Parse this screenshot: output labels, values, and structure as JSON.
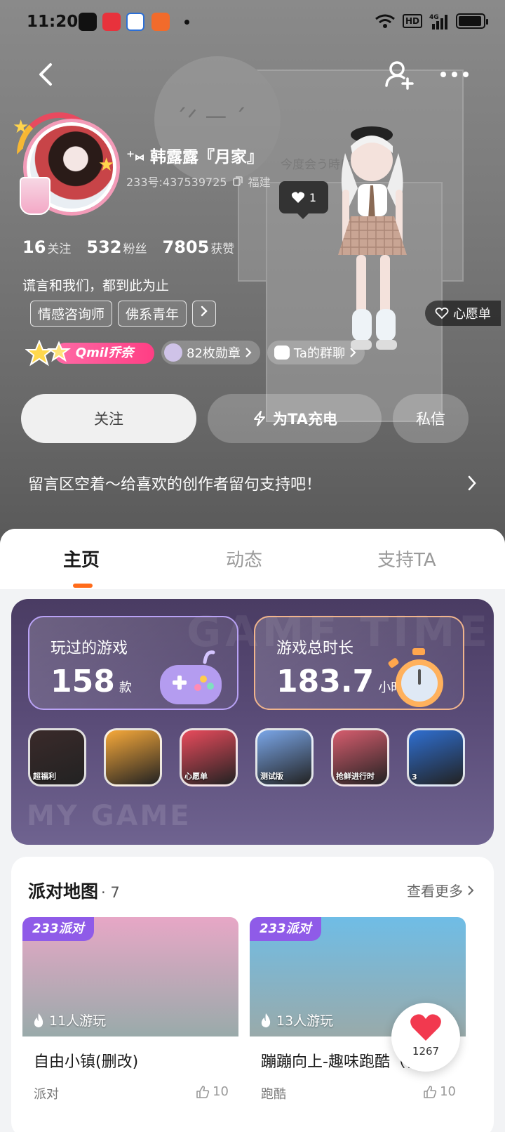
{
  "status_bar": {
    "time": "11:20",
    "network": "4G",
    "hd": "HD",
    "battery_percent": 95,
    "app_icons": [
      "douyin-icon",
      "xiaohongshu-icon",
      "music-icon",
      "video-icon"
    ]
  },
  "nav": {
    "back": "back-icon",
    "add_friend": "add-friend-icon",
    "more": "more-icon"
  },
  "profile": {
    "nickname": "韩露露『月家』",
    "nick_prefix": "⁺⑅",
    "id_label": "233号:437539725",
    "location": "福建",
    "stats": [
      {
        "num": "16",
        "label": "关注"
      },
      {
        "num": "532",
        "label": "粉丝"
      },
      {
        "num": "7805",
        "label": "获赞"
      }
    ],
    "bio": "谎言和我们，都到此为止",
    "tags": [
      "情感咨询师",
      "佛系青年"
    ],
    "vip_name": "Qmil乔奈",
    "medals": "82枚勋章",
    "group": "Ta的群聊",
    "avatar_like_count": "1",
    "wishlist": "心愿单"
  },
  "actions": {
    "follow": "关注",
    "charge": "为TA充电",
    "message": "私信"
  },
  "comment_banner": "留言区空着～给喜欢的创作者留句支持吧！",
  "tabs": [
    {
      "label": "主页",
      "active": true
    },
    {
      "label": "动态",
      "active": false
    },
    {
      "label": "支持TA",
      "active": false
    }
  ],
  "game_stats": {
    "watermark_top": "GAME TIME",
    "watermark_bottom": "MY GAME",
    "played_title": "玩过的游戏",
    "played_num": "158",
    "played_unit": "款",
    "duration_title": "游戏总时长",
    "duration_num": "183.7",
    "duration_unit": "小时",
    "colors": {
      "card_bg": "#5a4c78",
      "played_border": "#b9a2f5",
      "duration_border": "#f0b48d"
    }
  },
  "games": [
    {
      "icon": "sakura-school-girl-game-icon",
      "bg": "#3a2a2a",
      "label": "超福利"
    },
    {
      "icon": "anime-heroine-game-icon",
      "bg": "#f7a93a",
      "label": ""
    },
    {
      "icon": "wishlist-game-icon",
      "bg": "#e94b5c",
      "label": "心愿单"
    },
    {
      "icon": "sakura-school-game-icon",
      "bg": "#7aa6e8",
      "label": "测试版"
    },
    {
      "icon": "school-girls-game-icon",
      "bg": "#d65d6e",
      "label": "抢鲜进行时"
    },
    {
      "icon": "squid-doll-game-icon",
      "bg": "#2f6fd1",
      "label": "3"
    }
  ],
  "party": {
    "title": "派对地图",
    "count": "· 7",
    "more": "查看更多",
    "maps": [
      {
        "badge": "233派对",
        "players": "11人游玩",
        "name": "自由小镇(删改)",
        "category": "派对",
        "likes": "10",
        "bg": "#e7a7c6"
      },
      {
        "badge": "233派对",
        "players": "13人游玩",
        "name": "蹦蹦向上-趣味跑酷（稍...",
        "category": "跑酷",
        "likes": "10",
        "bg": "#6fbde6"
      }
    ]
  },
  "float_like": {
    "count": "1267"
  }
}
